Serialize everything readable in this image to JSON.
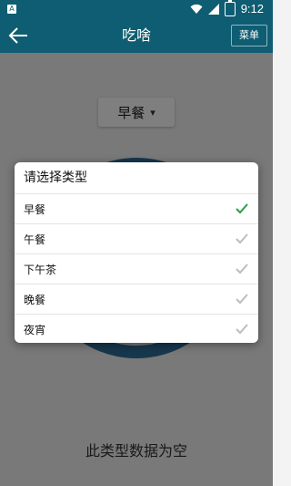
{
  "status_bar": {
    "sim_label": "A",
    "time": "9:12"
  },
  "toolbar": {
    "title": "吃啥",
    "menu_label": "菜单"
  },
  "selector": {
    "value": "早餐"
  },
  "empty_message": "此类型数据为空",
  "dialog": {
    "title": "请选择类型",
    "options": [
      {
        "label": "早餐",
        "selected": true
      },
      {
        "label": "午餐",
        "selected": false
      },
      {
        "label": "下午茶",
        "selected": false
      },
      {
        "label": "晚餐",
        "selected": false
      },
      {
        "label": "夜宵",
        "selected": false
      }
    ]
  },
  "colors": {
    "primary": "#0e5d72",
    "dial": "#2f6f9b",
    "check_selected": "#2a9d4a",
    "check_unselected": "#bdbdbd"
  }
}
